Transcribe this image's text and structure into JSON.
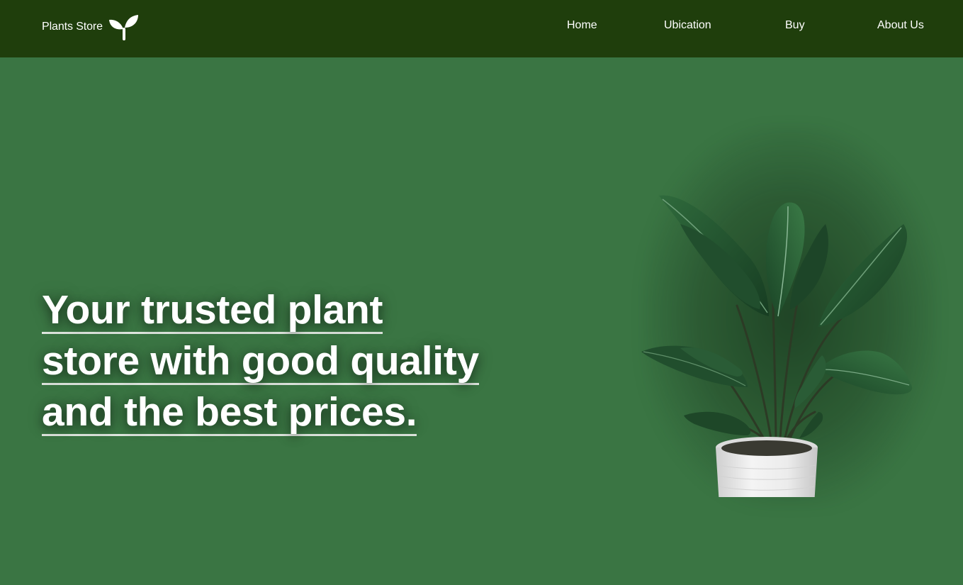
{
  "nav": {
    "brand": "Plants Store",
    "brand_icon": "sprout-icon",
    "links": [
      {
        "label": "Home"
      },
      {
        "label": "Ubication"
      },
      {
        "label": "Buy"
      },
      {
        "label": "About Us"
      }
    ]
  },
  "hero": {
    "headline_lines": [
      "Your trusted plant",
      "store with good quality",
      "and the best prices."
    ],
    "image": "potted-plant-image"
  },
  "colors": {
    "navbar_bg": "#1f3e0c",
    "hero_bg": "#3a7543",
    "text": "#ffffff",
    "underline": "#dfe6df",
    "leaf_dark": "#1f4d2b",
    "pot": "#e8e8e8"
  }
}
